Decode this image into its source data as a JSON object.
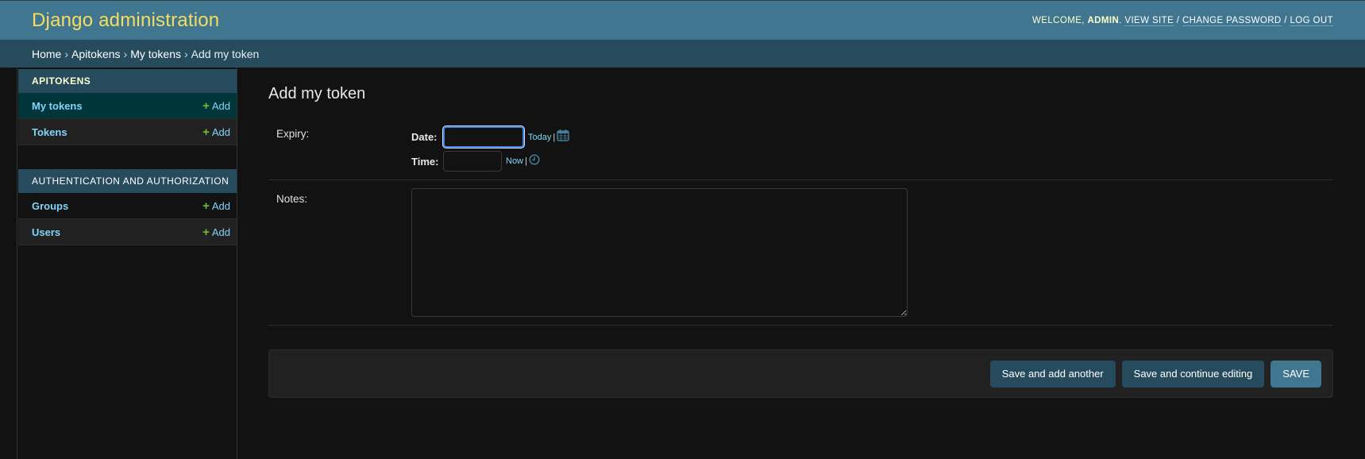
{
  "header": {
    "branding": "Django administration",
    "welcome_prefix": "Welcome, ",
    "username": "admin",
    "welcome_suffix": ".",
    "links": [
      "View site",
      "Change password",
      "Log out"
    ],
    "separator": "/"
  },
  "breadcrumbs": {
    "items": [
      "Home",
      "Apitokens",
      "My tokens"
    ],
    "current": "Add my token",
    "separator": "›"
  },
  "sidebar": {
    "modules": [
      {
        "caption": "Apitokens",
        "models": [
          {
            "name": "My tokens",
            "add_label": "Add",
            "active": true
          },
          {
            "name": "Tokens",
            "add_label": "Add",
            "active": false
          }
        ]
      },
      {
        "caption": "Authentication and Authorization",
        "models": [
          {
            "name": "Groups",
            "add_label": "Add",
            "active": false
          },
          {
            "name": "Users",
            "add_label": "Add",
            "active": false
          }
        ]
      }
    ]
  },
  "main": {
    "title": "Add my token",
    "expiry": {
      "label": "Expiry:",
      "date_label": "Date:",
      "date_value": "",
      "today_link": "Today",
      "time_label": "Time:",
      "time_value": "",
      "now_link": "Now",
      "shortcut_separator": "|",
      "calendar_icon": "calendar-icon",
      "clock_icon": "clock-icon"
    },
    "notes": {
      "label": "Notes:",
      "value": ""
    },
    "buttons": {
      "save_add_another": "Save and add another",
      "save_continue": "Save and continue editing",
      "save": "Save"
    }
  },
  "colors": {
    "header_bg": "#417690",
    "breadcrumbs_bg": "#264b5d",
    "branding": "#f5dd5d",
    "link": "#81d4fa",
    "add_icon": "#70bf2b",
    "active_row": "#00363a"
  }
}
